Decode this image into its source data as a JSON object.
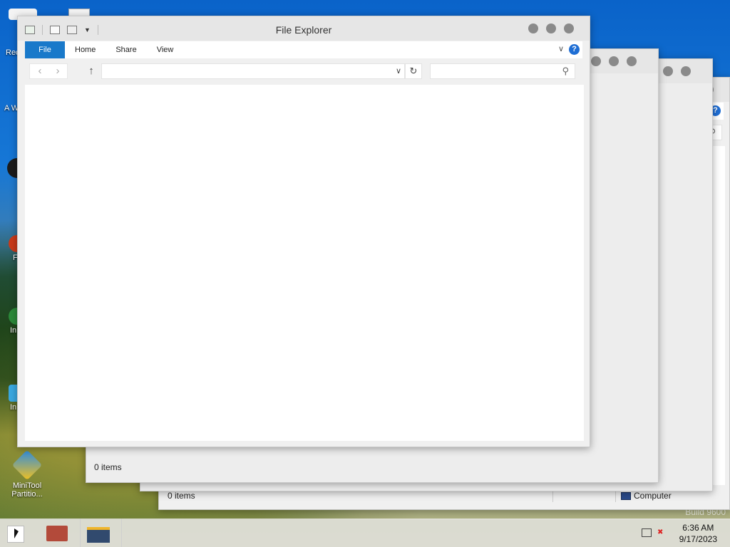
{
  "desktop": {
    "icons": [
      {
        "label": "Rec"
      },
      {
        "label": "A Win"
      },
      {
        "label": ""
      },
      {
        "label": "F"
      },
      {
        "label": "In"
      },
      {
        "label": "In Da"
      },
      {
        "label": "MiniTool Partitio..."
      }
    ],
    "watermark": "Build 9600"
  },
  "window_back2": {
    "status_items": "0 items",
    "status_computer": "Computer"
  },
  "window_back1": {
    "status_items": "0 items"
  },
  "explorer": {
    "title": "File Explorer",
    "tabs": [
      {
        "label": "File"
      },
      {
        "label": "Home"
      },
      {
        "label": "Share"
      },
      {
        "label": "View"
      }
    ],
    "help_label": "?",
    "address_value": "",
    "search_placeholder": ""
  },
  "taskbar": {
    "time": "6:36 AM",
    "date": "9/17/2023"
  },
  "colors": {
    "accent": "#1979ca",
    "help": "#1f6ed4"
  }
}
